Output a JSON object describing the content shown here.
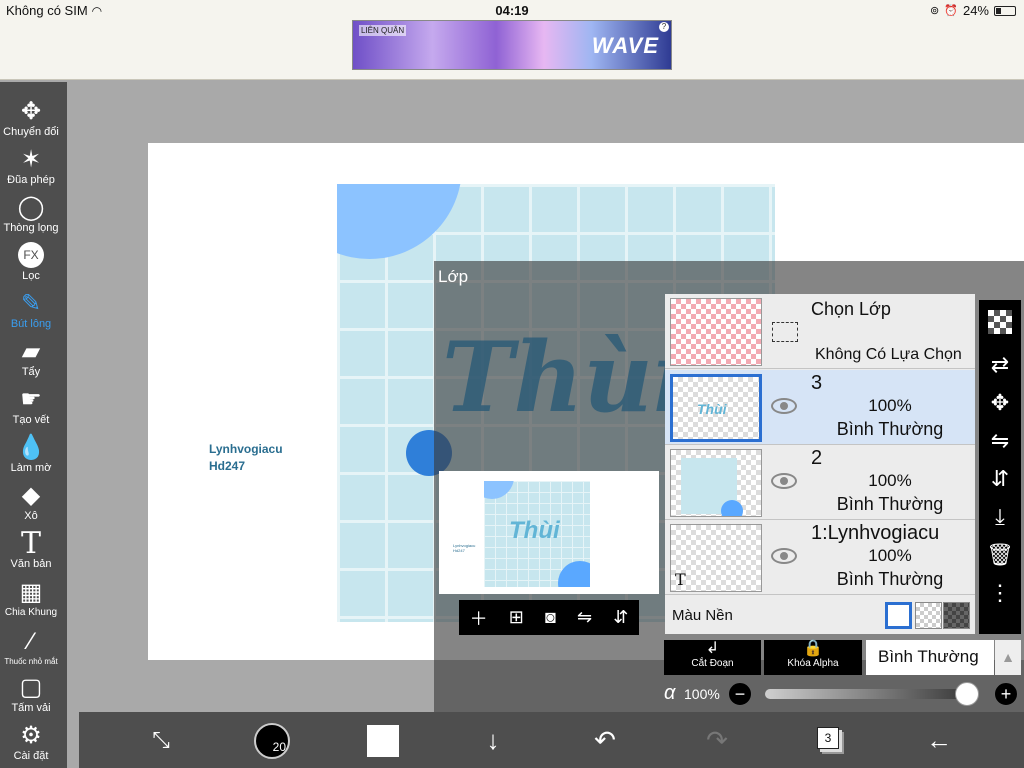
{
  "status": {
    "carrier": "Không có SIM",
    "time": "04:19",
    "battery": "24%"
  },
  "ad": {
    "brand": "LIÊN QUÂN",
    "wave": "WAVE",
    "info": "?"
  },
  "toolbar": {
    "items": [
      {
        "label": "Chuyển đổi",
        "icon": "move-arrows-icon"
      },
      {
        "label": "Đũa phép",
        "icon": "magic-wand-icon"
      },
      {
        "label": "Thòng lọng",
        "icon": "lasso-icon"
      },
      {
        "label": "Lọc",
        "icon": "fx-icon",
        "glyph": "FX"
      },
      {
        "label": "Bút lông",
        "icon": "brush-icon",
        "active": true
      },
      {
        "label": "Tẩy",
        "icon": "eraser-icon"
      },
      {
        "label": "Tạo vết",
        "icon": "smudge-icon"
      },
      {
        "label": "Làm mờ",
        "icon": "blur-drop-icon"
      },
      {
        "label": "Xô",
        "icon": "bucket-icon"
      },
      {
        "label": "Văn bản",
        "icon": "text-icon",
        "glyph": "T"
      },
      {
        "label": "Chia Khung",
        "icon": "frame-divider-icon"
      },
      {
        "label": "Thuốc nhỏ mắt",
        "icon": "eyedropper-icon"
      },
      {
        "label": "Tấm vải",
        "icon": "canvas-icon"
      },
      {
        "label": "Cài đặt",
        "icon": "gear-icon"
      }
    ]
  },
  "canvas": {
    "watermark_line1": "Lynhvogiacu",
    "watermark_line2": "Hd247",
    "artwork_text": "Thùi"
  },
  "layer_panel": {
    "title": "Lớp",
    "preview_text": "Thùi",
    "preview_watermark_line1": "Lynhvogiacu",
    "preview_watermark_line2": "Hd247",
    "preview_tools": [
      "add-layer-icon",
      "add-copy-icon",
      "camera-icon",
      "flip-horizontal-icon",
      "flip-vertical-icon"
    ],
    "selection": {
      "title": "Chọn Lớp",
      "state": "Không Có Lựa Chọn"
    },
    "layers": [
      {
        "name": "3",
        "opacity": "100%",
        "blend": "Bình Thường",
        "selected": true,
        "thumb_text": "Thùi"
      },
      {
        "name": "2",
        "opacity": "100%",
        "blend": "Bình Thường",
        "selected": false
      },
      {
        "name": "1:Lynhvogiacu",
        "opacity": "100%",
        "blend": "Bình Thường",
        "selected": false,
        "thumb_text": "T"
      }
    ],
    "background_label": "Màu Nền",
    "clip_label": "Cắt Đoạn",
    "alpha_lock_label": "Khóa Alpha",
    "blend_mode": "Bình Thường",
    "alpha_symbol": "α",
    "alpha_value": "100%",
    "alpha_fraction": 1.0,
    "side_tools": [
      "checker-icon",
      "transfer-icon",
      "move-icon",
      "flip-h-icon",
      "flip-v-icon",
      "merge-down-icon",
      "trash-icon",
      "more-icon"
    ]
  },
  "bottombar": {
    "brush_size": "20",
    "layer_count": "3"
  }
}
